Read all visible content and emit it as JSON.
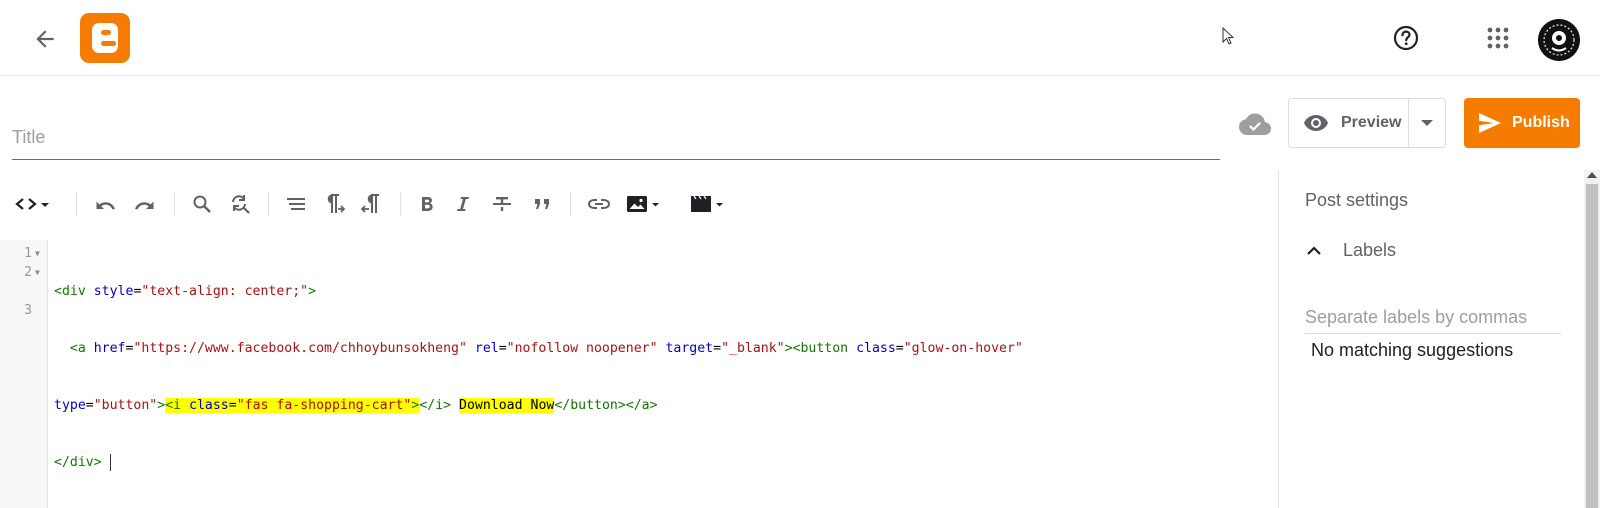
{
  "header": {
    "back_icon": "arrow-back-icon",
    "logo_icon": "blogger-logo-icon",
    "help_icon": "help-circle-icon",
    "apps_icon": "apps-grid-icon",
    "avatar_icon": "account-avatar"
  },
  "post": {
    "title_value": "",
    "title_placeholder": "Title",
    "cloud_icon": "cloud-done-icon",
    "preview_label": "Preview",
    "publish_label": "Publish",
    "accent_color": "#f57c00",
    "title_underline_color": "#e53935"
  },
  "toolbar": {
    "items": [
      "html-view-toggle-icon",
      "undo-icon",
      "redo-icon",
      "find-icon",
      "find-replace-icon",
      "format-html-icon",
      "ltr-paragraph-icon",
      "rtl-paragraph-icon",
      "bold-icon",
      "italic-icon",
      "strikethrough-icon",
      "quote-icon",
      "link-icon",
      "insert-image-icon",
      "insert-video-icon"
    ]
  },
  "editor": {
    "line_numbers": [
      "1",
      "2",
      "3"
    ],
    "l1": {
      "lt": "<",
      "tag": "div",
      "sp": " ",
      "attr": "style",
      "eq": "=",
      "val": "\"text-align: center;\"",
      "gt": ">"
    },
    "l2": {
      "indent": "  ",
      "a_open": "<a",
      "sp1": " ",
      "href_attr": "href",
      "eq1": "=",
      "href_val": "\"https://www.facebook.com/chhoybunsokheng\"",
      "sp2": " ",
      "rel_attr": "rel",
      "eq2": "=",
      "rel_val": "\"nofollow noopener\"",
      "sp3": " ",
      "target_attr": "target",
      "eq3": "=",
      "target_val": "\"_blank\"",
      "gt1": ">",
      "button_open": "<button",
      "sp4": " ",
      "class_attr": "class",
      "eq4": "=",
      "class_val": "\"glow-on-hover\""
    },
    "l2b": {
      "type_attr": "type",
      "eq": "=",
      "type_val": "\"button\"",
      "gt": ">",
      "i_open": "<i",
      "sp": " ",
      "i_class_attr": "class",
      "i_eq": "=",
      "i_class_val": "\"fas fa-shopping-cart\"",
      "i_gt": ">",
      "i_close": "</i>",
      "space": " ",
      "download_text": "Download Now",
      "button_close": "</button>",
      "a_close": "</a>"
    },
    "l3": {
      "div_close": "</div>"
    },
    "highlight_color": "#ffff00"
  },
  "post_settings": {
    "title": "Post settings",
    "labels_title": "Labels",
    "labels_value": "",
    "labels_placeholder": "Separate labels by commas",
    "no_match": "No matching suggestions"
  }
}
